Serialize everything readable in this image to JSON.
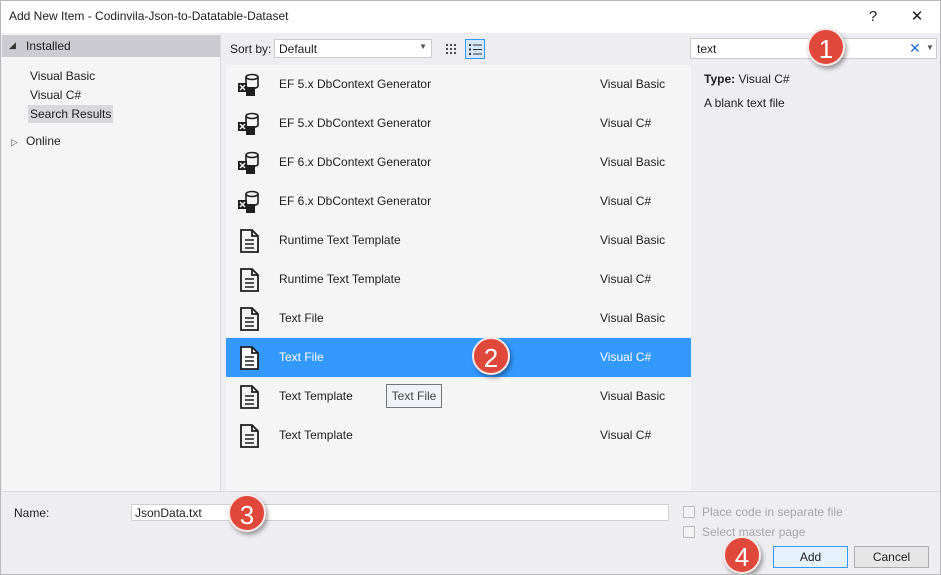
{
  "window": {
    "title": "Add New Item - Codinvila-Json-to-Datatable-Dataset",
    "help_label": "?",
    "close_label": "✕"
  },
  "tree": {
    "installed": "Installed",
    "items": [
      "Visual Basic",
      "Visual C#",
      "Search Results"
    ],
    "selected": "Search Results",
    "online": "Online"
  },
  "toolbar": {
    "sort_label": "Sort by:",
    "sort_value": "Default"
  },
  "templates": [
    {
      "name": "EF 5.x DbContext Generator",
      "lang": "Visual Basic",
      "icon": "ef-generator-icon"
    },
    {
      "name": "EF 5.x DbContext Generator",
      "lang": "Visual C#",
      "icon": "ef-generator-icon"
    },
    {
      "name": "EF 6.x DbContext Generator",
      "lang": "Visual Basic",
      "icon": "ef-generator-icon"
    },
    {
      "name": "EF 6.x DbContext Generator",
      "lang": "Visual C#",
      "icon": "ef-generator-icon"
    },
    {
      "name": "Runtime Text Template",
      "lang": "Visual Basic",
      "icon": "document-icon"
    },
    {
      "name": "Runtime Text Template",
      "lang": "Visual C#",
      "icon": "document-icon"
    },
    {
      "name": "Text File",
      "lang": "Visual Basic",
      "icon": "document-icon"
    },
    {
      "name": "Text File",
      "lang": "Visual C#",
      "icon": "document-icon",
      "selected": true
    },
    {
      "name": "Text Template",
      "lang": "Visual Basic",
      "icon": "document-icon"
    },
    {
      "name": "Text Template",
      "lang": "Visual C#",
      "icon": "document-icon"
    }
  ],
  "tooltip": "Text File",
  "search": {
    "value": "text",
    "clear_label": "✕"
  },
  "detail": {
    "type_label": "Type:",
    "type_value": "Visual C#",
    "description": "A blank text file"
  },
  "form": {
    "name_label": "Name:",
    "name_value": "JsonData.txt",
    "place_code_label": "Place code in separate file",
    "master_page_label": "Select master page",
    "add_label": "Add",
    "cancel_label": "Cancel"
  },
  "callouts": [
    "1",
    "2",
    "3",
    "4"
  ],
  "colors": {
    "selection": "#3399ff",
    "callout": "#e0483c",
    "clear_x": "#1e6fd9"
  }
}
